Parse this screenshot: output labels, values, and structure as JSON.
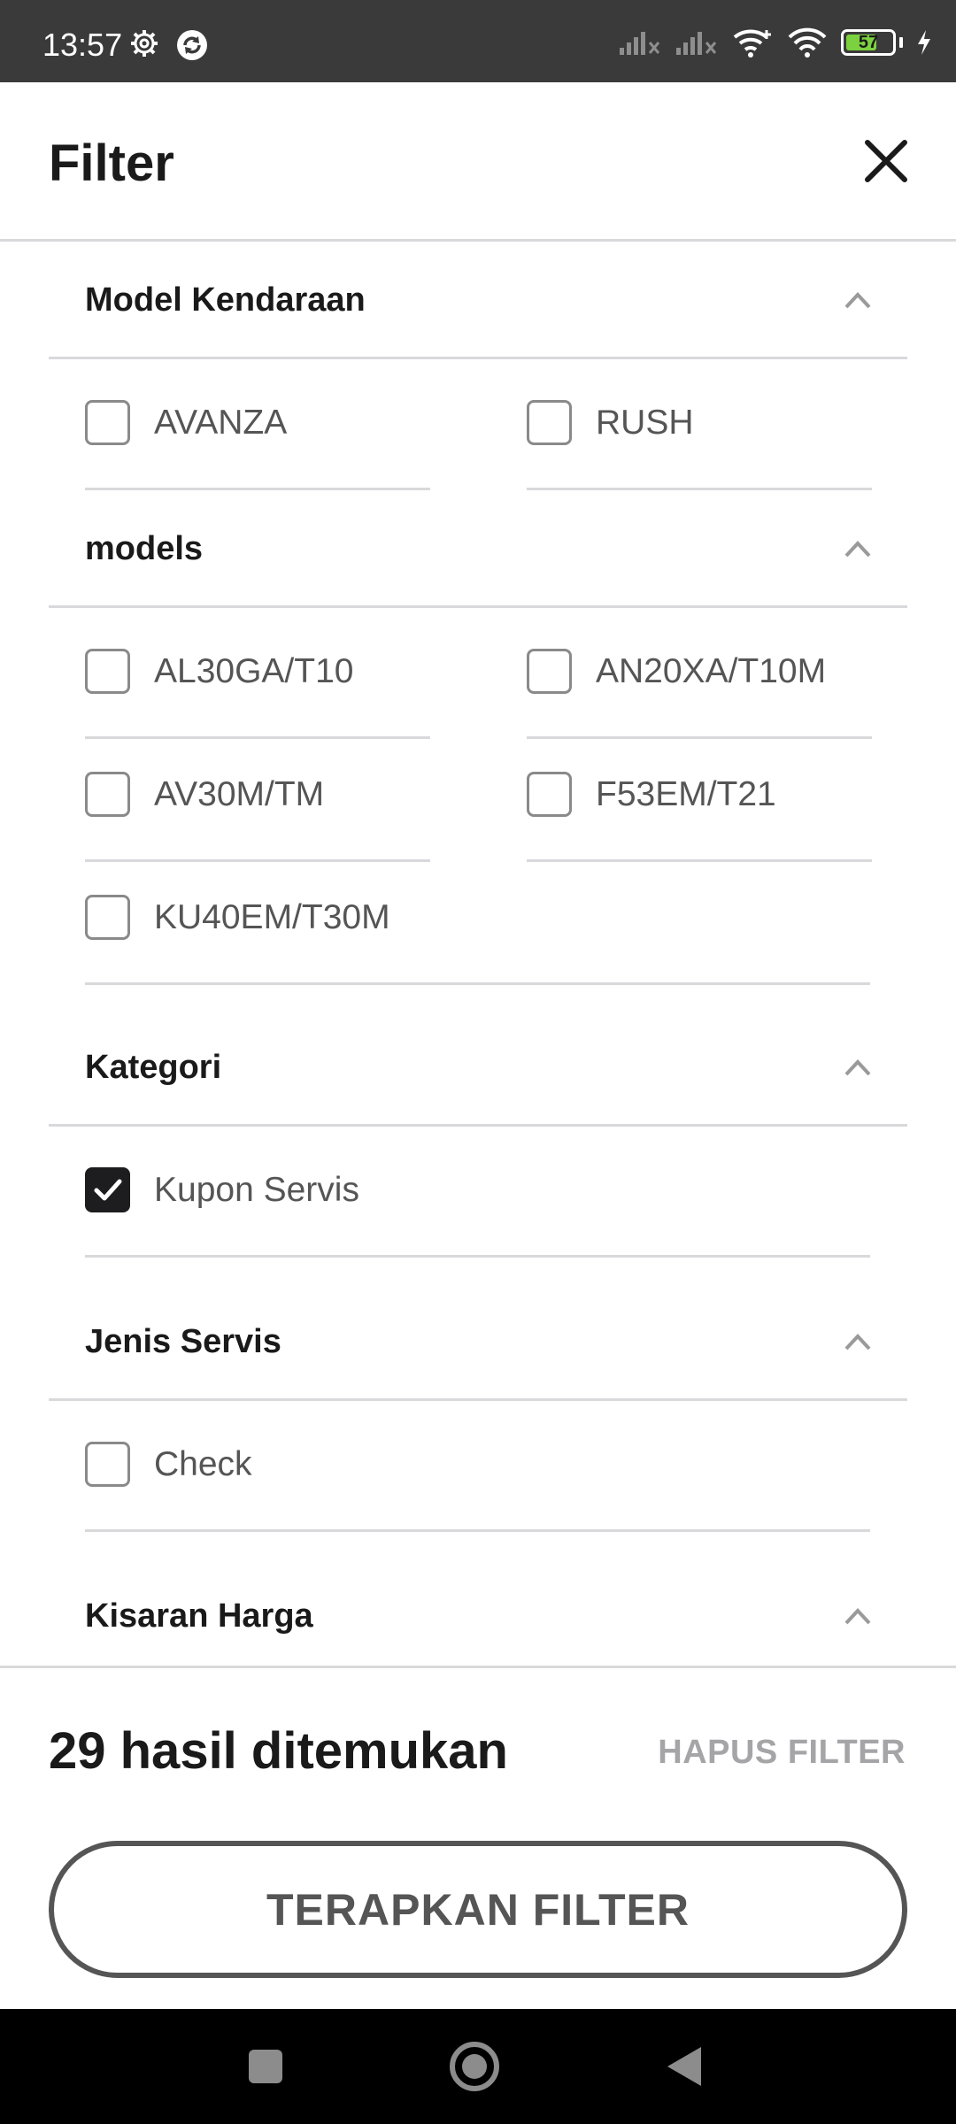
{
  "status_bar": {
    "time": "13:57",
    "battery_level": "57",
    "icons": [
      "gear-icon",
      "sync-icon",
      "signal-icon",
      "signal-icon",
      "wifi-icon",
      "wifi-icon",
      "battery-icon",
      "charging-icon"
    ]
  },
  "header": {
    "title": "Filter",
    "close_icon": "close-icon"
  },
  "sections": {
    "model_kendaraan": {
      "title": "Model Kendaraan",
      "options": [
        {
          "label": "AVANZA",
          "checked": false
        },
        {
          "label": "RUSH",
          "checked": false
        }
      ]
    },
    "models": {
      "title": "models",
      "options": [
        {
          "label": "AL30GA/T10",
          "checked": false
        },
        {
          "label": "AN20XA/T10M",
          "checked": false
        },
        {
          "label": "AV30M/TM",
          "checked": false
        },
        {
          "label": "F53EM/T21",
          "checked": false
        },
        {
          "label": "KU40EM/T30M",
          "checked": false
        }
      ]
    },
    "kategori": {
      "title": "Kategori",
      "options": [
        {
          "label": "Kupon Servis",
          "checked": true
        }
      ]
    },
    "jenis_servis": {
      "title": "Jenis Servis",
      "options": [
        {
          "label": "Check",
          "checked": false
        }
      ]
    },
    "kisaran_harga": {
      "title": "Kisaran Harga"
    }
  },
  "footer": {
    "results": "29 hasil ditemukan",
    "clear_label": "HAPUS FILTER",
    "apply_label": "TERAPKAN FILTER"
  },
  "colors": {
    "status_bar_bg": "#3a3a3a",
    "text_primary": "#1a1a1a",
    "text_secondary": "#555555",
    "divider": "#d9d9dc",
    "disabled_text": "#a5a5a8",
    "battery_green": "#7bd23e",
    "nav_bar_bg": "#000000"
  },
  "nav_bar": {
    "buttons": [
      "recents-icon",
      "home-icon",
      "back-icon"
    ]
  }
}
